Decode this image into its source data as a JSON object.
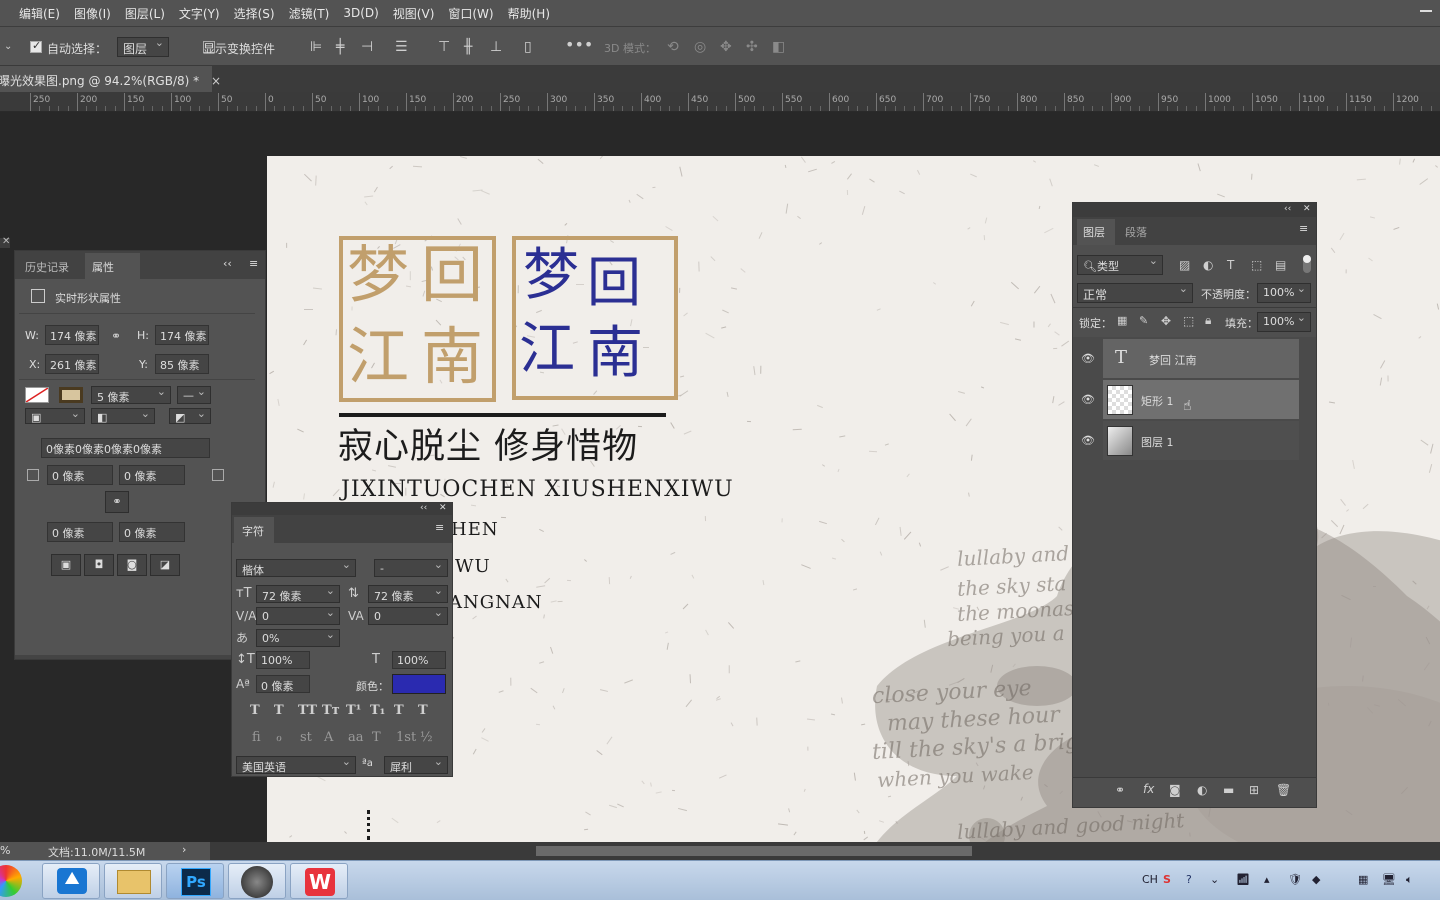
{
  "menubar": {
    "items": [
      "编辑(E)",
      "图像(I)",
      "图层(L)",
      "文字(Y)",
      "选择(S)",
      "滤镜(T)",
      "3D(D)",
      "视图(V)",
      "窗口(W)",
      "帮助(H)"
    ]
  },
  "options": {
    "auto_select_label": "自动选择：",
    "auto_select_value": "图层",
    "show_transform_label": "显示变换控件",
    "mode_3d_label": "3D 模式："
  },
  "document": {
    "tab_title": "曝光效果图.png @ 94.2%(RGB/8) *",
    "close_glyph": "×"
  },
  "ruler": {
    "labels": [
      "250",
      "200",
      "150",
      "100",
      "50",
      "0",
      "50",
      "100",
      "150",
      "200",
      "250",
      "300",
      "350",
      "400",
      "450",
      "500",
      "550",
      "600",
      "650",
      "700",
      "750",
      "800",
      "850",
      "900",
      "950",
      "1000",
      "1050",
      "1100",
      "1150",
      "1200"
    ]
  },
  "artwork": {
    "box1_chars": [
      "梦",
      "回",
      "江",
      "南"
    ],
    "box2_chars": [
      "梦",
      "回",
      "江",
      "南"
    ],
    "tagline_cn": "寂心脱尘 修身惜物",
    "tagline_en": "JIXINTUOCHEN XIUSHENXIWU",
    "line_hen": "HEN",
    "line_wu": "WU",
    "line_angnan": "ANGNAN",
    "ink_text": [
      "lullaby and",
      "the sky sta",
      "the moonas",
      "being you a",
      "close your eye",
      "may these hour",
      "till the sky's a bright",
      "when you wake",
      "lullaby and good night"
    ],
    "colors": {
      "gold": "#c19f6c",
      "blue": "#2b2f93",
      "ink": "#1c1c1c"
    }
  },
  "props_panel": {
    "tab_history": "历史记录",
    "tab_properties": "属性",
    "title": "实时形状属性",
    "w_label": "W:",
    "w_value": "174 像素",
    "h_label": "H:",
    "h_value": "174 像素",
    "x_label": "X:",
    "x_value": "261 像素",
    "y_label": "Y:",
    "y_value": "85 像素",
    "stroke_width": "5 像素",
    "radius_summary": "0像素0像素0像素0像素",
    "r1": "0 像素",
    "r2": "0 像素",
    "r3": "0 像素",
    "r4": "0 像素"
  },
  "char_panel": {
    "tab": "字符",
    "font_family": "楷体",
    "font_style": "-",
    "size": "72 像素",
    "leading": "72 像素",
    "kerning": "0",
    "tracking": "0",
    "scale_pct": "0%",
    "vscale": "100%",
    "hscale": "100%",
    "baseline": "0 像素",
    "color_label": "颜色：",
    "color": "#2a2ab0",
    "style_buttons": [
      "T",
      "T",
      "TT",
      "Tт",
      "T¹",
      "T₁",
      "T",
      "T"
    ],
    "ot_buttons": [
      "fi",
      "ℴ",
      "st",
      "A",
      "aa",
      "T",
      "1st",
      "½"
    ],
    "language": "美国英语",
    "aa_label": "ªa",
    "antialias": "犀利"
  },
  "layers_panel": {
    "tab_layers": "图层",
    "tab_paragraph": "段落",
    "filter_kind": "类型",
    "blend_mode": "正常",
    "opacity_label": "不透明度：",
    "opacity": "100%",
    "lock_label": "锁定：",
    "fill_label": "填充：",
    "fill": "100%",
    "layers": [
      {
        "name": "梦回 江南",
        "kind": "text"
      },
      {
        "name": "矩形 1",
        "kind": "shape"
      },
      {
        "name": "图层 1",
        "kind": "image"
      }
    ]
  },
  "status": {
    "zoom_hint": "%",
    "doc_size": "文档:11.0M/11.5M",
    "arrow": "›"
  },
  "taskbar": {
    "tray_lang": "CH",
    "ps_label": "Ps"
  }
}
